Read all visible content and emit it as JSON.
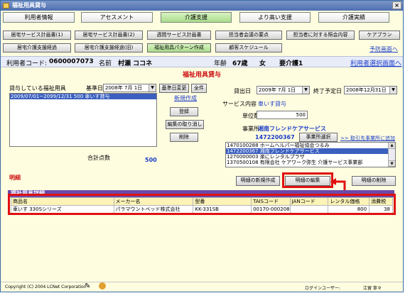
{
  "window": {
    "title": "福祉用具貸与",
    "close": "×"
  },
  "tabs": [
    "利用者情報",
    "アセスメント",
    "介護支援",
    "より高い支援",
    "介護実績"
  ],
  "row1": [
    "居宅サービス計画書(1)",
    "居宅サービス計画書(2)",
    "週間サービス計画書",
    "担当者会議の要点",
    "担当者に対する照会内容",
    "ケアプラン"
  ],
  "row2": [
    "居宅介護支援経過",
    "居宅介護支援経過(旧)",
    "福祉用具パターン作成",
    "顧客スケジュール"
  ],
  "links": {
    "yobou": "予防画面へ",
    "user_select": "利用者選択画面へ",
    "new_create": "新規作成",
    "add_office": ">> 取引先事業所に追加"
  },
  "user": {
    "code_label": "利用者コード:",
    "code": "0600007073",
    "name_label": "名前",
    "name": "村瀬 ココネ",
    "age_label": "年齢",
    "age": "67歳",
    "sex": "女",
    "care_level": "要介護1"
  },
  "page_title": "福祉用具貸与",
  "left": {
    "lending_label": "貸与している福祉用具",
    "base_date_label": "基準日",
    "base_date": "2008年 7月 1日",
    "base_change": "基準日変更",
    "all_btn": "全件",
    "list": [
      "2009/07/01~2099/12/31 500 車いす貸与"
    ],
    "register": "登録",
    "cancel_edit": "編集の取り消し",
    "delete": "削除",
    "total_label": "合計点数",
    "total": "500"
  },
  "right": {
    "start_label": "貸出日",
    "start": "2009年 7月 1日",
    "end_label": "終了予定日",
    "end": "2008年12月31日",
    "service_label": "サービス内容",
    "service": "車いす貸与",
    "units_label": "単位数",
    "units": "500",
    "office_label": "事業所",
    "office_name": "湘南フレンドケアサービス",
    "office_code": "1472200367",
    "office_select": "事業所選択",
    "offices": [
      "1470100288 ホームヘルパー福祉協会つるみ",
      "1472200367 湘南フレンドケアサービス",
      "1270000003 楽にレンタルプラザ",
      "1370500108 有限会社 ケアワーク弥生 介護サービス事業部"
    ]
  },
  "detail": {
    "section_label": "明細",
    "new_btn": "明細の新規作成",
    "edit_btn": "明細の編集",
    "delete_btn": "明細の削除",
    "header_bar": "福祉用具詳細",
    "columns": [
      "商品名",
      "メーカー名",
      "型番",
      "TAISコード",
      "JANコード",
      "レンタル価格",
      "消費税"
    ],
    "rows": [
      [
        "車いす 330Sシリーズ",
        "パラマウントベッド株式会社",
        "KK-331SB",
        "00170-000208",
        "",
        "800",
        "38"
      ]
    ]
  },
  "footer": {
    "copyright": "Copyright (C) 2004 LCNet Corporation",
    "login_label": "ログインユーザー:",
    "login_user": "江留 寧々"
  }
}
